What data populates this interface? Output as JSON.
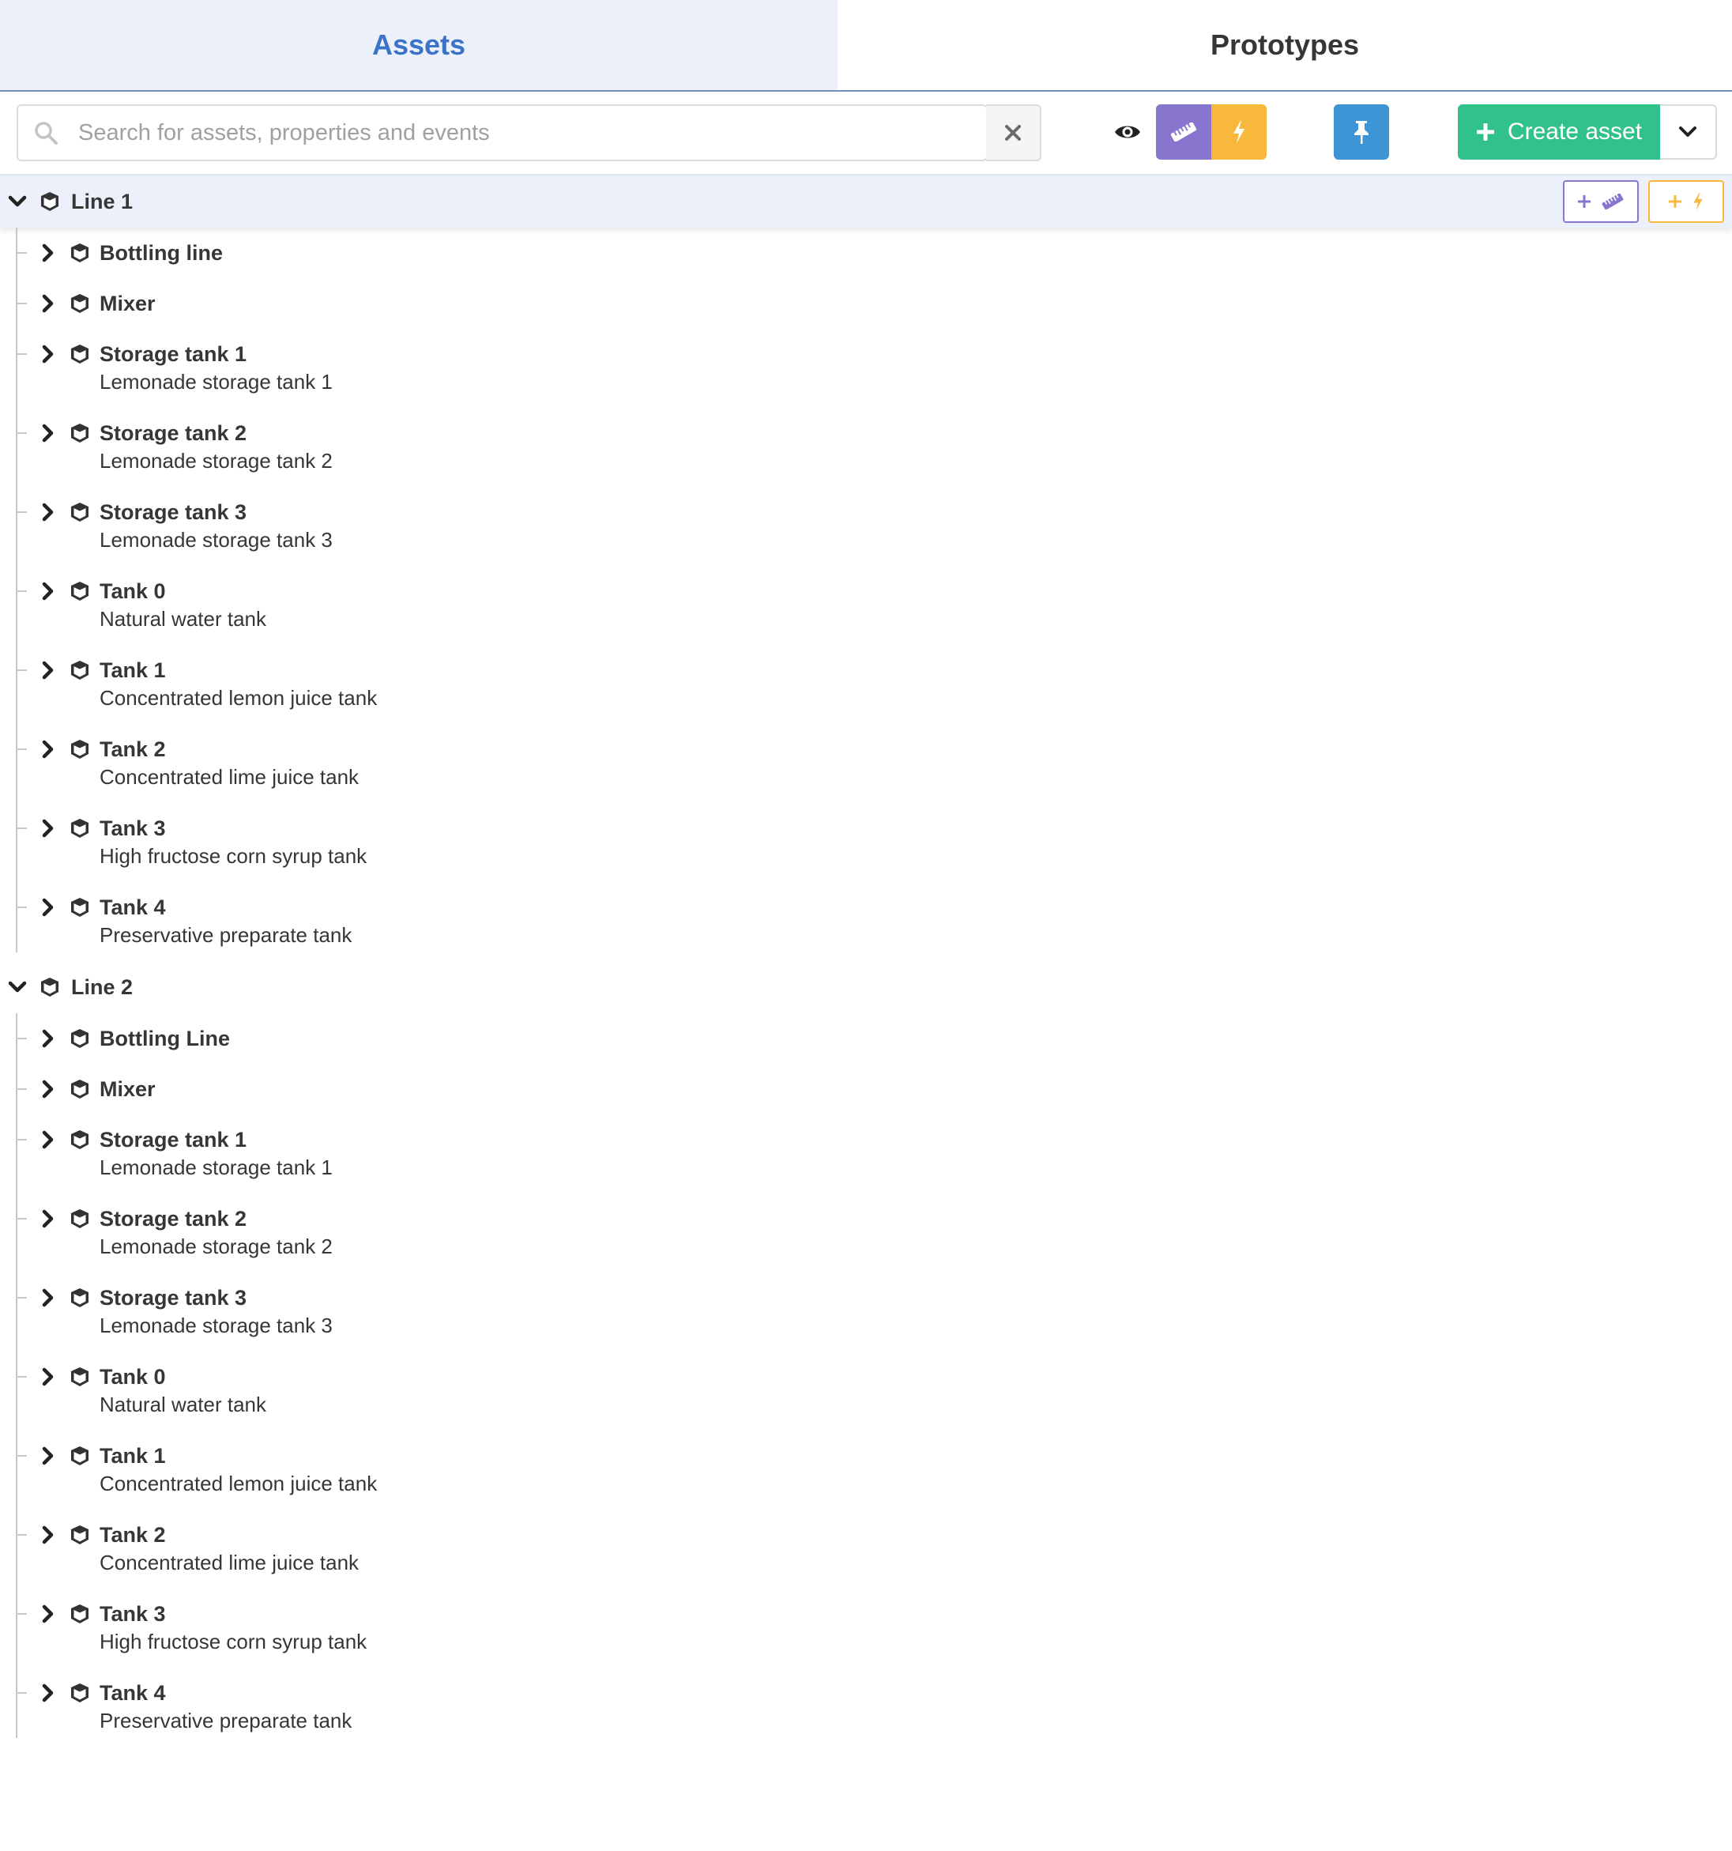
{
  "tabs": {
    "assets": "Assets",
    "prototypes": "Prototypes"
  },
  "search": {
    "placeholder": "Search for assets, properties and events",
    "value": ""
  },
  "toolbar": {
    "create_label": "Create asset"
  },
  "colors": {
    "accent_blue": "#3b73c8",
    "measure_purple": "#8875cd",
    "event_orange": "#f8b83c",
    "pin_blue": "#3e95d6",
    "create_green": "#30c28a"
  },
  "lines": [
    {
      "title": "Line 1",
      "children": [
        {
          "title": "Bottling line",
          "desc": ""
        },
        {
          "title": "Mixer",
          "desc": ""
        },
        {
          "title": "Storage tank 1",
          "desc": "Lemonade storage tank 1"
        },
        {
          "title": "Storage tank 2",
          "desc": "Lemonade storage tank 2"
        },
        {
          "title": "Storage tank 3",
          "desc": "Lemonade storage tank 3"
        },
        {
          "title": "Tank 0",
          "desc": "Natural water tank"
        },
        {
          "title": "Tank 1",
          "desc": "Concentrated lemon juice tank"
        },
        {
          "title": "Tank 2",
          "desc": "Concentrated lime juice tank"
        },
        {
          "title": "Tank 3",
          "desc": "High fructose corn syrup tank"
        },
        {
          "title": "Tank 4",
          "desc": "Preservative preparate tank"
        }
      ]
    },
    {
      "title": "Line 2",
      "children": [
        {
          "title": "Bottling Line",
          "desc": ""
        },
        {
          "title": "Mixer",
          "desc": ""
        },
        {
          "title": "Storage tank 1",
          "desc": "Lemonade storage tank 1"
        },
        {
          "title": "Storage tank 2",
          "desc": "Lemonade storage tank 2"
        },
        {
          "title": "Storage tank 3",
          "desc": "Lemonade storage tank 3"
        },
        {
          "title": "Tank 0",
          "desc": "Natural water tank"
        },
        {
          "title": "Tank 1",
          "desc": "Concentrated lemon juice tank"
        },
        {
          "title": "Tank 2",
          "desc": "Concentrated lime juice tank"
        },
        {
          "title": "Tank 3",
          "desc": "High fructose corn syrup tank"
        },
        {
          "title": "Tank 4",
          "desc": "Preservative preparate tank"
        }
      ]
    }
  ]
}
